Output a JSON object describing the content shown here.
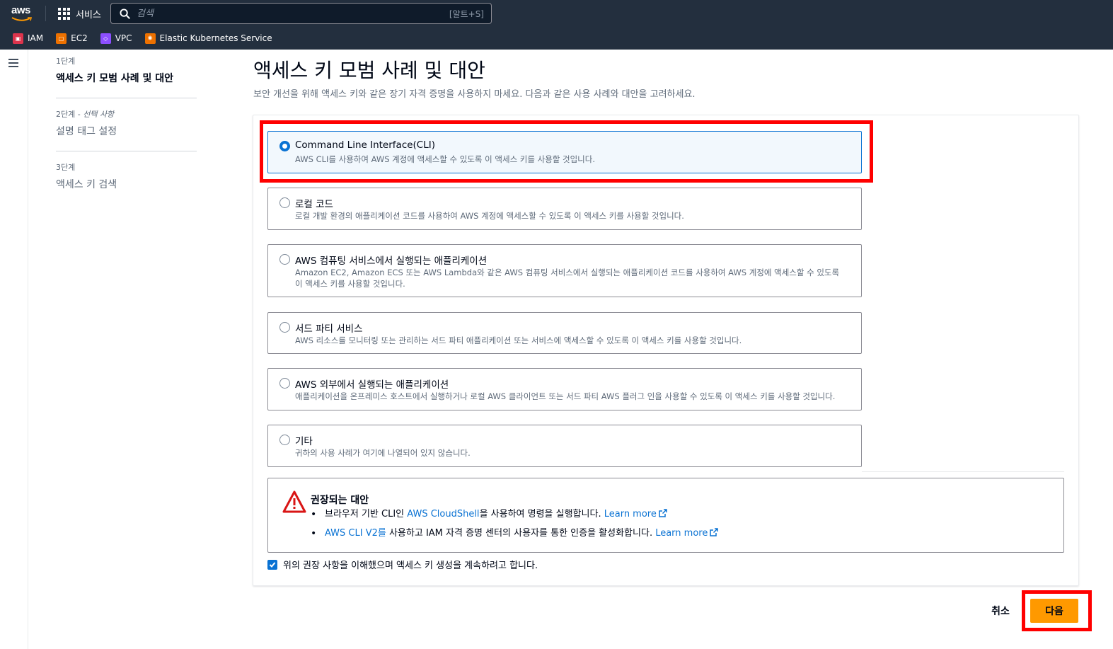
{
  "topnav": {
    "logo_text": "aws",
    "services_label": "서비스",
    "search_placeholder": "검색",
    "search_shortcut": "[알트+S]",
    "favorites": [
      {
        "label": "IAM",
        "icon": "iam-icon",
        "color": "#dd344c"
      },
      {
        "label": "EC2",
        "icon": "ec2-icon",
        "color": "#ed7100"
      },
      {
        "label": "VPC",
        "icon": "vpc-icon",
        "color": "#8c4fff"
      },
      {
        "label": "Elastic Kubernetes Service",
        "icon": "eks-icon",
        "color": "#ed7100"
      }
    ]
  },
  "steps": [
    {
      "number": "1단계",
      "optional": "",
      "title": "액세스 키 모범 사례 및 대안",
      "active": true
    },
    {
      "number": "2단계 - ",
      "optional": "선택 사항",
      "title": "설명 태그 설정",
      "active": false
    },
    {
      "number": "3단계",
      "optional": "",
      "title": "액세스 키 검색",
      "active": false
    }
  ],
  "main": {
    "title": "액세스 키 모범 사례 및 대안",
    "description": "보안 개선을 위해 액세스 키와 같은 장기 자격 증명을 사용하지 마세요. 다음과 같은 사용 사례와 대안을 고려하세요.",
    "options": [
      {
        "title": "Command Line Interface(CLI)",
        "description": "AWS CLI를 사용하여 AWS 계정에 액세스할 수 있도록 이 액세스 키를 사용할 것입니다.",
        "selected": true
      },
      {
        "title": "로컬 코드",
        "description": "로컬 개발 환경의 애플리케이션 코드를 사용하여 AWS 계정에 액세스할 수 있도록 이 액세스 키를 사용할 것입니다.",
        "selected": false
      },
      {
        "title": "AWS 컴퓨팅 서비스에서 실행되는 애플리케이션",
        "description": "Amazon EC2, Amazon ECS 또는 AWS Lambda와 같은 AWS 컴퓨팅 서비스에서 실행되는 애플리케이션 코드를 사용하여 AWS 계정에 액세스할 수 있도록 이 액세스 키를 사용할 것입니다.",
        "selected": false
      },
      {
        "title": "서드 파티 서비스",
        "description": "AWS 리소스를 모니터링 또는 관리하는 서드 파티 애플리케이션 또는 서비스에 액세스할 수 있도록 이 액세스 키를 사용할 것입니다.",
        "selected": false
      },
      {
        "title": "AWS 외부에서 실행되는 애플리케이션",
        "description": "애플리케이션을 온프레미스 호스트에서 실행하거나 로컬 AWS 클라이언트 또는 서드 파티 AWS 플러그 인을 사용할 수 있도록 이 액세스 키를 사용할 것입니다.",
        "selected": false
      },
      {
        "title": "기타",
        "description": "귀하의 사용 사례가 여기에 나열되어 있지 않습니다.",
        "selected": false
      }
    ],
    "alert": {
      "title": "권장되는 대안",
      "item1_before": "브라우저 기반 CLI인 ",
      "item1_link": "AWS CloudShell",
      "item1_after": "을 사용하여 명령을 실행합니다. ",
      "item2_link": "AWS CLI V2를",
      "item2_after": " 사용하고 IAM 자격 증명 센터의 사용자를 통한 인증을 활성화합니다. ",
      "learn_more": "Learn more"
    },
    "acknowledge": "위의 권장 사항을 이해했으며 액세스 키 생성을 계속하려고 합니다.",
    "acknowledge_checked": true
  },
  "footer": {
    "cancel_label": "취소",
    "next_label": "다음"
  },
  "colors": {
    "nav_bg": "#232f3e",
    "accent_blue": "#0972d3",
    "primary_button": "#ff9900",
    "highlight_red": "#ff0000",
    "warning_red": "#d91515"
  }
}
